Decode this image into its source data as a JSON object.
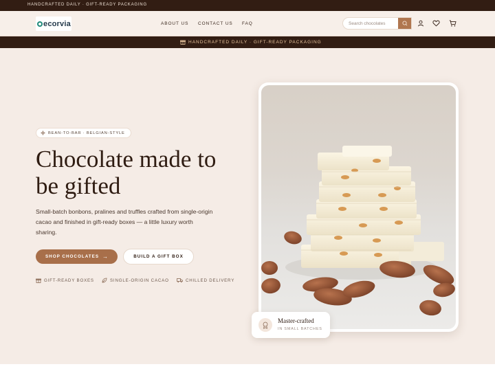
{
  "topbar": {
    "text": "Handcrafted daily · Gift-ready packaging"
  },
  "header": {
    "logo_text": "ecorvia",
    "nav": [
      "About us",
      "Contact us",
      "FAQ"
    ],
    "search_placeholder": "Search chocolates",
    "icons": [
      "search-icon",
      "user-icon",
      "heart-icon",
      "cart-icon"
    ]
  },
  "promo": {
    "text": "Handcrafted daily · Gift-ready packaging",
    "icon": "gift-icon"
  },
  "hero": {
    "pill": "Bean-to-bar · Belgian-style",
    "title_line1": "Chocolate made to",
    "title_line2": "be gifted",
    "lead": "Small-batch bonbons, pralines and truffles crafted from single-origin cacao and finished in gift-ready boxes — a little luxury worth sharing.",
    "primary_cta": "Shop chocolates",
    "secondary_cta": "Build a gift box",
    "features": [
      {
        "label": "Gift-ready boxes",
        "icon": "gift-icon"
      },
      {
        "label": "Single-origin cacao",
        "icon": "leaf-icon"
      },
      {
        "label": "Chilled delivery",
        "icon": "truck-icon"
      }
    ]
  },
  "badge": {
    "title": "Master-crafted",
    "subtitle": "In small batches",
    "icon": "award-icon"
  },
  "colors": {
    "dark": "#321d13",
    "accent": "#a86f4a",
    "background": "#f5ece6",
    "promo_text": "#e8c59e"
  }
}
